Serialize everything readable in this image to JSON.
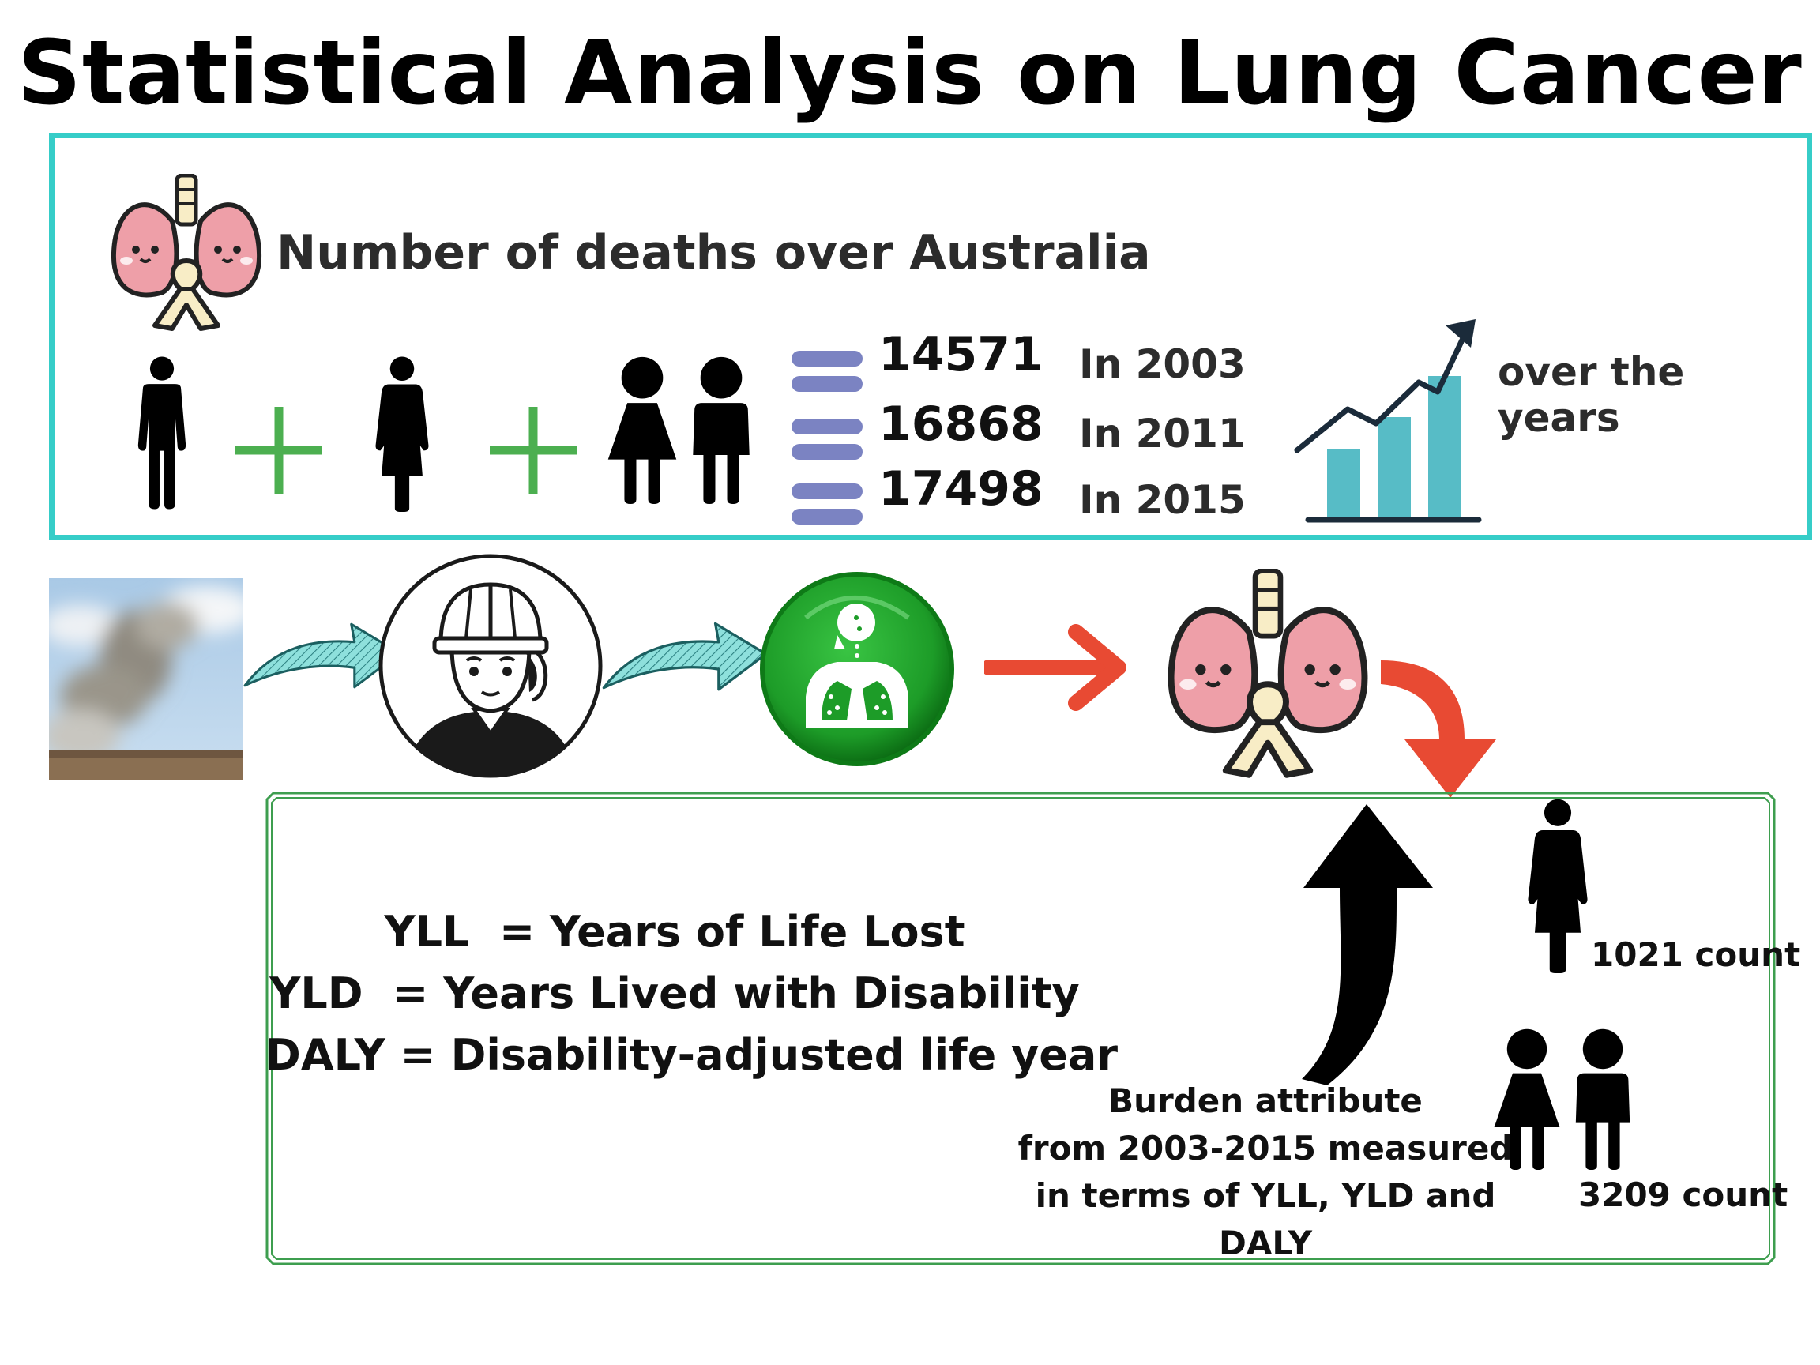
{
  "title": "Statistical Analysis on Lung Cancer",
  "deaths": {
    "heading": "Number of deaths over Australia",
    "stats": [
      {
        "count": "14571",
        "year": "In 2003"
      },
      {
        "count": "16868",
        "year": "In 2011"
      },
      {
        "count": "17498",
        "year": "In 2015"
      }
    ],
    "trend_label": "over the years"
  },
  "definitions": [
    "YLL  = Years of Life Lost",
    "YLD  = Years Lived with Disability",
    "DALY = Disability-adjusted life year"
  ],
  "burden": {
    "note_lines": [
      "Burden attribute",
      "from 2003-2015 measured",
      "in terms of YLL, YLD and DALY"
    ],
    "women_count": "1021 count",
    "children_count": "3209 count"
  },
  "icons": [
    "lungs-ribbon-icon",
    "man-icon",
    "woman-icon",
    "children-icon",
    "plus-icon",
    "equals-icon",
    "growth-chart-icon",
    "smoke-photo",
    "worker-icon",
    "lung-disease-icon",
    "arrow-right-icon",
    "arrow-down-icon",
    "arrow-up-icon"
  ],
  "colors": {
    "panel_border": "#36cdc8",
    "plus": "#4caf50",
    "equals": "#7b83c2",
    "chart_bar": "#57bcc6",
    "green_circle": "#21a12a",
    "red_arrow": "#e84a33",
    "teal_arrow": "#8ee0dc",
    "lung_pink": "#ee9fa8",
    "ribbon": "#f8edc6"
  }
}
